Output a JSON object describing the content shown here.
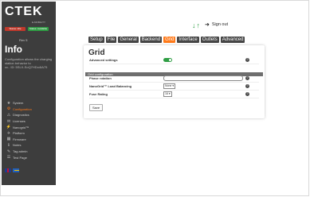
{
  "sidebar": {
    "logo": "CTEK",
    "subtitle": "E-MOBILITY",
    "status": [
      {
        "label": "Status: Idle",
        "color": "#c0392b"
      },
      {
        "label": "Status: Available",
        "color": "#2f9e44"
      }
    ],
    "small_text": "Rev 5",
    "info_title": "Info",
    "info_text": "Configuration allows the charging station behavior to",
    "info_text2": "cc.. ID: 5SLX-SoQ7HDo4tA75",
    "nav": [
      {
        "label": "System",
        "icon": "star-icon",
        "glyph": "★"
      },
      {
        "label": "Configuration",
        "icon": "gear-icon",
        "glyph": "⚙",
        "active": true
      },
      {
        "label": "Diagnostics",
        "icon": "diagnostics-icon",
        "glyph": "⚠"
      },
      {
        "label": "Licenses",
        "icon": "licenses-icon",
        "glyph": "✉"
      },
      {
        "label": "Nanogrid™",
        "icon": "nanogrid-icon",
        "glyph": "⚡"
      },
      {
        "label": "Platform",
        "icon": "platform-icon",
        "glyph": "✈"
      },
      {
        "label": "Firmware",
        "icon": "firmware-icon",
        "glyph": "▦"
      },
      {
        "label": "Notes",
        "icon": "notes-icon",
        "glyph": "ℹ"
      },
      {
        "label": "Tag admin",
        "icon": "tag-icon",
        "glyph": "✎"
      },
      {
        "label": "Test Page",
        "icon": "test-page-icon",
        "glyph": "☰"
      }
    ]
  },
  "topbar": {
    "sign_out": "Sign out"
  },
  "tabs": [
    "Setup",
    "File",
    "General",
    "Backend",
    "Grid",
    "Interface",
    "Outlets",
    "Advanced"
  ],
  "active_tab": "Grid",
  "panel": {
    "title": "Grid",
    "advanced_label": "Advanced settings",
    "section": "Grid configuration",
    "rows": [
      {
        "label": "Phase rotation",
        "value": ""
      },
      {
        "label": "NanoGrid™ Load Balancing",
        "value": "None ▾"
      },
      {
        "label": "Fuse Rating",
        "value": "16 ▾"
      }
    ],
    "save": "Save"
  },
  "colors": {
    "accent": "#ff7a1a",
    "sidebar_bg": "#3d3d3d",
    "toggle_on": "#2f9e44"
  }
}
